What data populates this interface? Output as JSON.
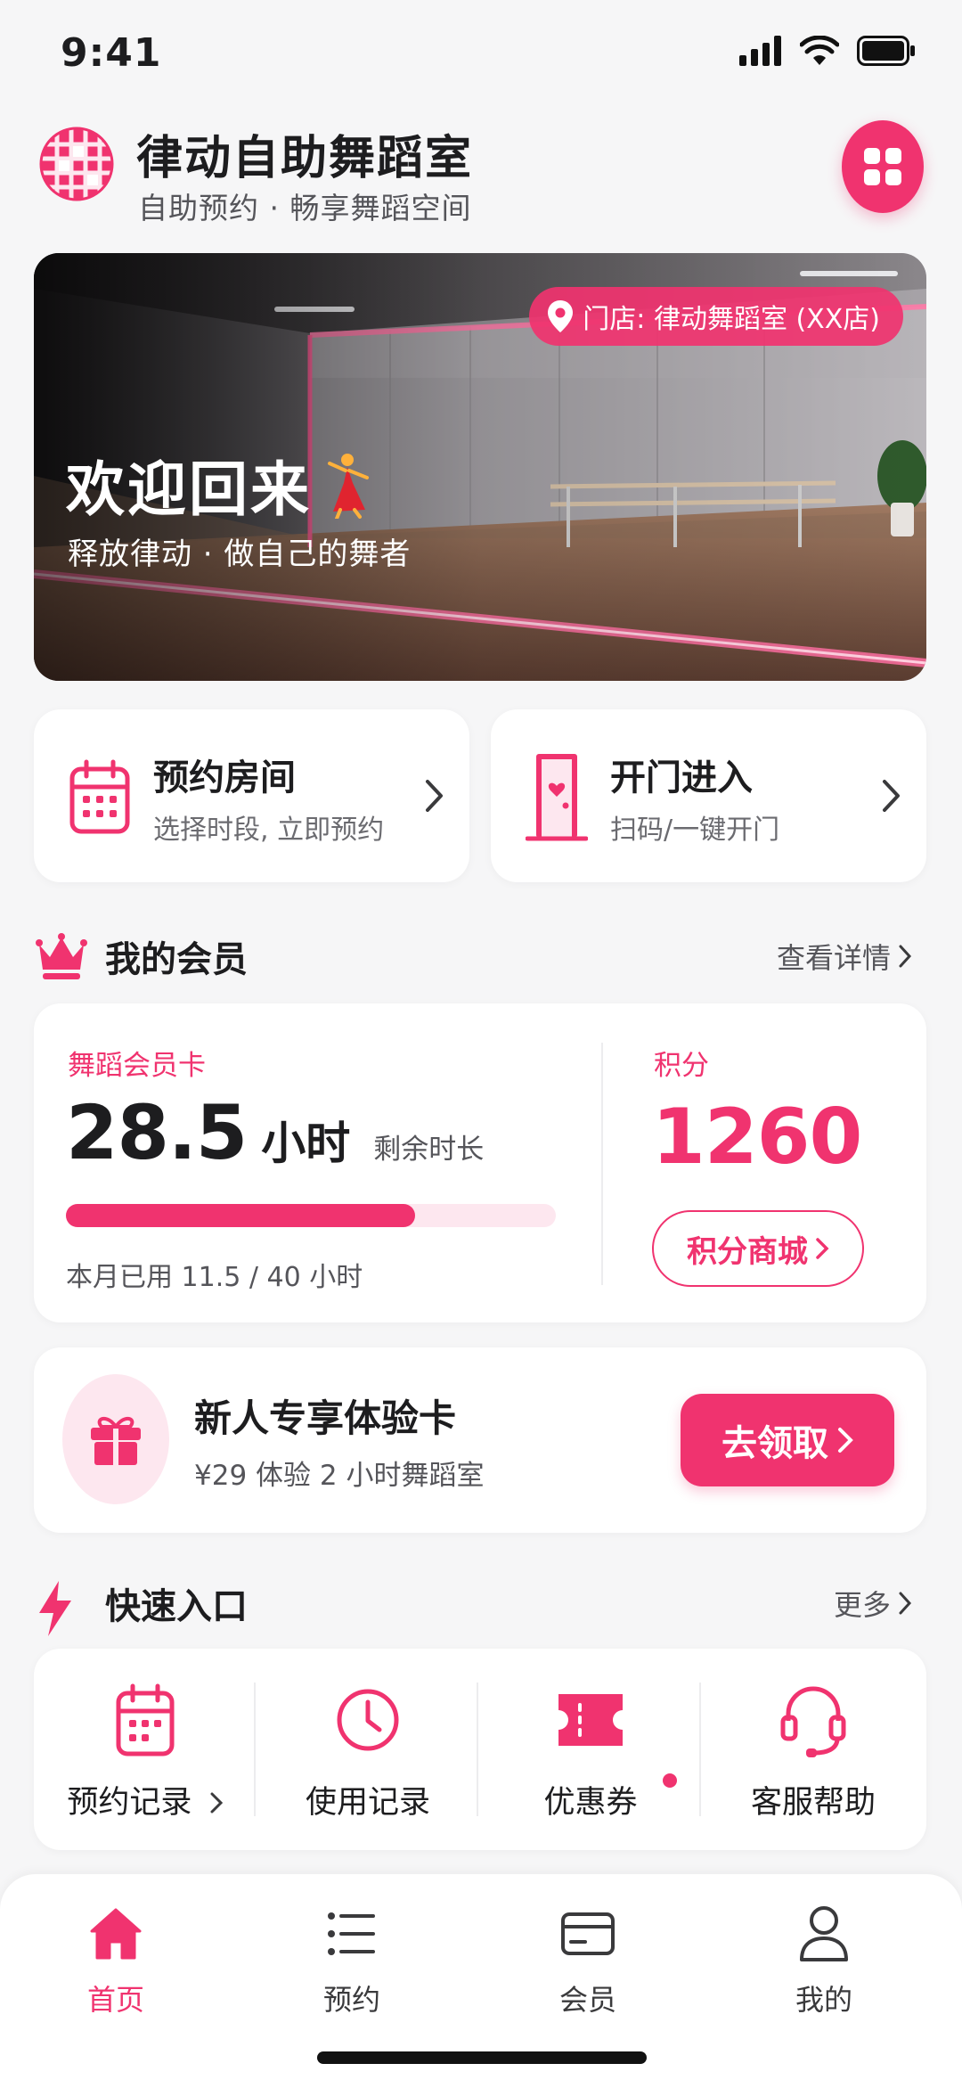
{
  "status": {
    "time": "9:41"
  },
  "header": {
    "title": "律动自助舞蹈室",
    "subtitle": "自助预约 · 畅享舞蹈空间"
  },
  "banner": {
    "store": "门店: 律动舞蹈室 (XX店)",
    "title": "欢迎回来",
    "subtitle": "释放律动 · 做自己的舞者"
  },
  "actions": [
    {
      "title": "预约房间",
      "subtitle": "选择时段, 立即预约"
    },
    {
      "title": "开门进入",
      "subtitle": "扫码/一键开门"
    }
  ],
  "membership": {
    "section_title": "我的会员",
    "more_label": "查看详情",
    "card_label": "舞蹈会员卡",
    "hours": "28.5",
    "hours_unit": "小时",
    "hours_note": "剩余时长",
    "usage_text": "本月已用 11.5 / 40 小时",
    "usage_fraction": 0.7125,
    "points_label": "积分",
    "points": "1260",
    "points_button": "积分商城"
  },
  "gift": {
    "title": "新人专享体验卡",
    "subtitle": "¥29 体验 2 小时舞蹈室",
    "button": "去领取"
  },
  "quick": {
    "section_title": "快速入口",
    "more_label": "更多",
    "items": [
      {
        "label": "预约记录",
        "icon": "calendar-icon"
      },
      {
        "label": "使用记录",
        "icon": "clock-icon"
      },
      {
        "label": "优惠券",
        "icon": "ticket-icon"
      },
      {
        "label": "客服帮助",
        "icon": "headset-icon"
      }
    ]
  },
  "tabs": [
    {
      "label": "首页",
      "icon": "home-icon",
      "active": true
    },
    {
      "label": "预约",
      "icon": "list-icon",
      "active": false
    },
    {
      "label": "会员",
      "icon": "card-icon",
      "active": false
    },
    {
      "label": "我的",
      "icon": "user-icon",
      "active": false
    }
  ],
  "colors": {
    "accent": "#f0336f",
    "accent_light": "#fde7ef",
    "background": "#f6f6f7"
  }
}
